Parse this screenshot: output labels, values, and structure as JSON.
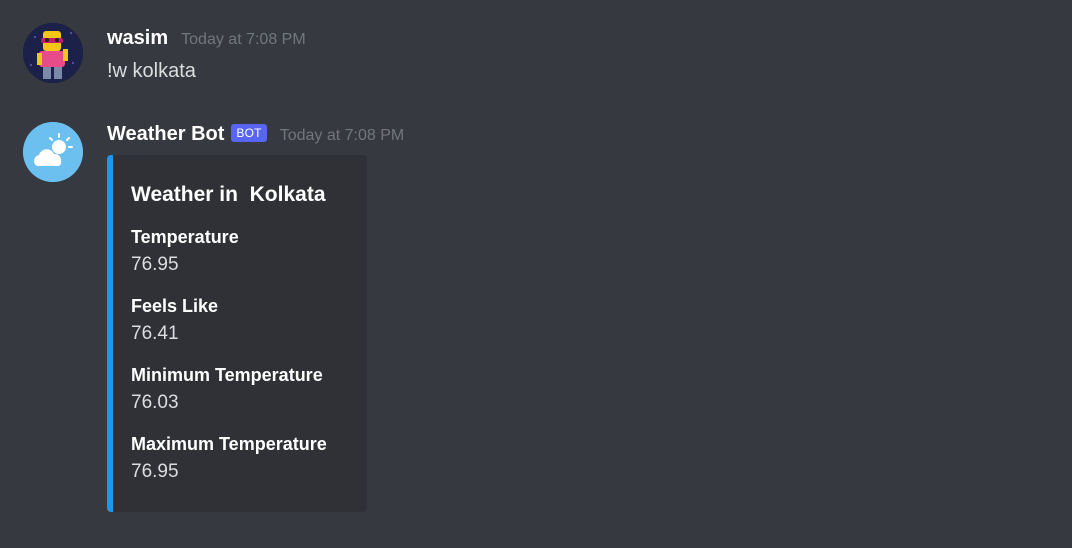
{
  "messages": [
    {
      "username": "wasim",
      "timestamp": "Today at 7:08 PM",
      "text": "!w kolkata"
    },
    {
      "username": "Weather Bot",
      "badge": "BOT",
      "timestamp": "Today at 7:08 PM",
      "embed": {
        "accent_color": "#1e96f0",
        "title": "Weather in  Kolkata",
        "fields": [
          {
            "name": "Temperature",
            "value": "76.95"
          },
          {
            "name": "Feels Like",
            "value": "76.41"
          },
          {
            "name": "Minimum Temperature",
            "value": "76.03"
          },
          {
            "name": "Maximum Temperature",
            "value": "76.95"
          }
        ]
      }
    }
  ],
  "icons": {
    "user_avatar": "cartoon-character-avatar",
    "bot_avatar": "sun-cloud-weather-icon"
  },
  "colors": {
    "background": "#36393f",
    "embed_background": "#2f3136",
    "bot_tag": "#5865f2"
  }
}
